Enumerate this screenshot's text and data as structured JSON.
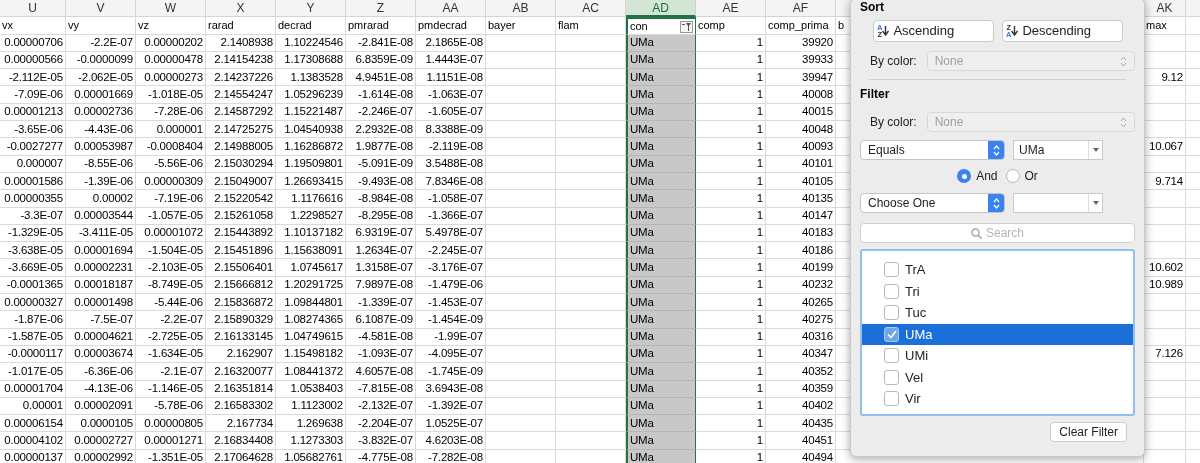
{
  "sheet": {
    "columns": [
      {
        "letter": "U",
        "name": "vx",
        "kind": "number",
        "selected": false,
        "filter": false
      },
      {
        "letter": "V",
        "name": "vy",
        "kind": "number",
        "selected": false,
        "filter": false
      },
      {
        "letter": "W",
        "name": "vz",
        "kind": "number",
        "selected": false,
        "filter": false
      },
      {
        "letter": "X",
        "name": "rarad",
        "kind": "number",
        "selected": false,
        "filter": false
      },
      {
        "letter": "Y",
        "name": "decrad",
        "kind": "number",
        "selected": false,
        "filter": false
      },
      {
        "letter": "Z",
        "name": "pmrarad",
        "kind": "number",
        "selected": false,
        "filter": false
      },
      {
        "letter": "AA",
        "name": "pmdecrad",
        "kind": "number",
        "selected": false,
        "filter": false
      },
      {
        "letter": "AB",
        "name": "bayer",
        "kind": "text",
        "selected": false,
        "filter": false
      },
      {
        "letter": "AC",
        "name": "flam",
        "kind": "text",
        "selected": false,
        "filter": false
      },
      {
        "letter": "AD",
        "name": "con",
        "kind": "text",
        "selected": true,
        "filter": true
      },
      {
        "letter": "AE",
        "name": "comp",
        "kind": "number",
        "selected": false,
        "filter": false
      },
      {
        "letter": "AF",
        "name": "comp_prima",
        "kind": "number",
        "selected": false,
        "filter": false
      },
      {
        "name": "b",
        "kind": "text",
        "selected": false,
        "filter": false
      },
      {
        "letter": "AK",
        "name": "max",
        "kind": "number",
        "selected": false,
        "filter": false
      }
    ],
    "rows": [
      [
        "0.00000706",
        "-2.2E-07",
        "0.00000202",
        "2.1408938",
        "1.10224546",
        "-2.841E-08",
        "2.1865E-08",
        null,
        null,
        "UMa",
        "1",
        "39920",
        null,
        null
      ],
      [
        "0.00000566",
        "-0.0000099",
        "0.00000478",
        "2.14154238",
        "1.17308688",
        "6.8359E-09",
        "1.4443E-07",
        null,
        null,
        "UMa",
        "1",
        "39933",
        null,
        null
      ],
      [
        "-2.112E-05",
        "-2.062E-05",
        "0.00000273",
        "2.14237226",
        "1.1383528",
        "4.9451E-08",
        "1.1151E-08",
        null,
        null,
        "UMa",
        "1",
        "39947",
        null,
        "9.12"
      ],
      [
        "-7.09E-06",
        "0.00001669",
        "-1.018E-05",
        "2.14554247",
        "1.05296239",
        "-1.614E-08",
        "-1.063E-07",
        null,
        null,
        "UMa",
        "1",
        "40008",
        null,
        null
      ],
      [
        "0.00001213",
        "0.00002736",
        "-7.28E-06",
        "2.14587292",
        "1.15221487",
        "-2.246E-07",
        "-1.605E-07",
        null,
        null,
        "UMa",
        "1",
        "40015",
        null,
        null
      ],
      [
        "-3.65E-06",
        "-4.43E-06",
        "0.000001",
        "2.14725275",
        "1.04540938",
        "2.2932E-08",
        "8.3388E-09",
        null,
        null,
        "UMa",
        "1",
        "40048",
        null,
        null
      ],
      [
        "-0.0027277",
        "0.00053987",
        "-0.0008404",
        "2.14988005",
        "1.16286872",
        "1.9877E-08",
        "-2.119E-08",
        null,
        null,
        "UMa",
        "1",
        "40093",
        null,
        "10.067"
      ],
      [
        "0.000007",
        "-8.55E-06",
        "-5.56E-06",
        "2.15030294",
        "1.19509801",
        "-5.091E-09",
        "3.5488E-08",
        null,
        null,
        "UMa",
        "1",
        "40101",
        null,
        null
      ],
      [
        "0.00001586",
        "-1.39E-06",
        "0.00000309",
        "2.15049007",
        "1.26693415",
        "-9.493E-08",
        "7.8346E-08",
        null,
        null,
        "UMa",
        "1",
        "40105",
        null,
        "9.714"
      ],
      [
        "0.00000355",
        "0.00002",
        "-7.19E-06",
        "2.15220542",
        "1.1176616",
        "-8.984E-08",
        "-1.058E-07",
        null,
        null,
        "UMa",
        "1",
        "40135",
        null,
        null
      ],
      [
        "-3.3E-07",
        "0.00003544",
        "-1.057E-05",
        "2.15261058",
        "1.2298527",
        "-8.295E-08",
        "-1.366E-07",
        null,
        null,
        "UMa",
        "1",
        "40147",
        null,
        null
      ],
      [
        "-1.329E-05",
        "-3.411E-05",
        "0.00001072",
        "2.15443892",
        "1.10137182",
        "6.9319E-07",
        "5.4978E-07",
        null,
        null,
        "UMa",
        "1",
        "40183",
        null,
        null
      ],
      [
        "-3.638E-05",
        "0.00001694",
        "-1.504E-05",
        "2.15451896",
        "1.15638091",
        "1.2634E-07",
        "-2.245E-07",
        null,
        null,
        "UMa",
        "1",
        "40186",
        null,
        null
      ],
      [
        "-3.669E-05",
        "0.00002231",
        "-2.103E-05",
        "2.15506401",
        "1.0745617",
        "1.3158E-07",
        "-3.176E-07",
        null,
        null,
        "UMa",
        "1",
        "40199",
        null,
        "10.602"
      ],
      [
        "-0.0001365",
        "0.00018187",
        "-8.749E-05",
        "2.15666812",
        "1.20291725",
        "7.9897E-08",
        "-1.479E-06",
        null,
        null,
        "UMa",
        "1",
        "40232",
        null,
        "10.989"
      ],
      [
        "0.00000327",
        "0.00001498",
        "-5.44E-06",
        "2.15836872",
        "1.09844801",
        "-1.339E-07",
        "-1.453E-07",
        null,
        null,
        "UMa",
        "1",
        "40265",
        null,
        null
      ],
      [
        "-1.87E-06",
        "-7.5E-07",
        "-2.2E-07",
        "2.15890329",
        "1.08274365",
        "6.1087E-09",
        "-1.454E-09",
        null,
        null,
        "UMa",
        "1",
        "40275",
        null,
        null
      ],
      [
        "-1.587E-05",
        "0.00004621",
        "-2.725E-05",
        "2.16133145",
        "1.04749615",
        "-4.581E-08",
        "-1.99E-07",
        null,
        null,
        "UMa",
        "1",
        "40316",
        null,
        null
      ],
      [
        "-0.0000117",
        "0.00003674",
        "-1.634E-05",
        "2.162907",
        "1.15498182",
        "-1.093E-07",
        "-4.095E-07",
        null,
        null,
        "UMa",
        "1",
        "40347",
        null,
        "7.126"
      ],
      [
        "-1.017E-05",
        "-6.36E-06",
        "-2.1E-07",
        "2.16320077",
        "1.08441372",
        "4.6057E-08",
        "-1.745E-09",
        null,
        null,
        "UMa",
        "1",
        "40352",
        null,
        null
      ],
      [
        "0.00001704",
        "-4.13E-06",
        "-1.146E-05",
        "2.16351814",
        "1.0538403",
        "-7.815E-08",
        "3.6943E-08",
        null,
        null,
        "UMa",
        "1",
        "40359",
        null,
        null
      ],
      [
        "0.00001",
        "0.00002091",
        "-5.78E-06",
        "2.16583302",
        "1.1123002",
        "-2.132E-07",
        "-1.392E-07",
        null,
        null,
        "UMa",
        "1",
        "40402",
        null,
        null
      ],
      [
        "0.00006154",
        "0.0000105",
        "0.00000805",
        "2.167734",
        "1.269638",
        "-2.204E-07",
        "1.0525E-07",
        null,
        null,
        "UMa",
        "1",
        "40435",
        null,
        null
      ],
      [
        "0.00004102",
        "0.00002727",
        "0.00001271",
        "2.16834408",
        "1.1273303",
        "-3.832E-07",
        "4.6203E-08",
        null,
        null,
        "UMa",
        "1",
        "40451",
        null,
        null
      ],
      [
        "0.00000137",
        "0.00002992",
        "-1.351E-05",
        "2.17064628",
        "1.05682761",
        "-4.775E-08",
        "-7.282E-08",
        null,
        null,
        "UMa",
        "1",
        "40494",
        null,
        null
      ]
    ]
  },
  "filter_popup": {
    "sort_title": "Sort",
    "sort_buttons": [
      {
        "kind": "ascending",
        "label": "Ascending",
        "icon_top": "A",
        "icon_bottom": "Z"
      },
      {
        "kind": "descending",
        "label": "Descending",
        "icon_top": "Z",
        "icon_bottom": "A"
      }
    ],
    "sort_by_color": {
      "label": "By color:",
      "value": "None",
      "disabled": true
    },
    "filter_title": "Filter",
    "filter_by_color": {
      "label": "By color:",
      "value": "None",
      "disabled": true
    },
    "conditions": [
      {
        "operator": "Equals",
        "value": "UMa"
      },
      {
        "operator": "Choose One"
      }
    ],
    "logic": [
      {
        "label": "And",
        "selected": true
      },
      {
        "label": "Or",
        "selected": false
      }
    ],
    "search": {
      "placeholder": "Search"
    },
    "values": [
      {
        "label": "TrA",
        "checked": false,
        "selected": false
      },
      {
        "label": "Tri",
        "checked": false,
        "selected": false
      },
      {
        "label": "Tuc",
        "checked": false,
        "selected": false
      },
      {
        "label": "UMa",
        "checked": true,
        "selected": true
      },
      {
        "label": "UMi",
        "checked": false,
        "selected": false
      },
      {
        "label": "Vel",
        "checked": false,
        "selected": false
      },
      {
        "label": "Vir",
        "checked": false,
        "selected": false
      }
    ],
    "clear_button": "Clear Filter"
  }
}
